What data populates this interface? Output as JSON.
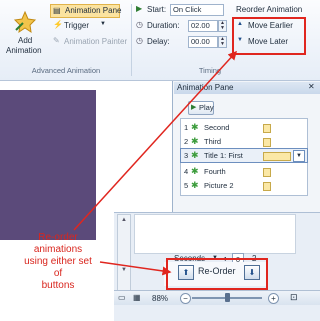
{
  "ribbon": {
    "add_animation_label_1": "Add",
    "add_animation_label_2": "Animation",
    "animation_pane_label": "Animation Pane",
    "trigger_label": "Trigger",
    "animation_painter_label": "Animation Painter",
    "group_advanced_animation": "Advanced Animation",
    "start_label": "Start:",
    "start_value": "On Click",
    "duration_label": "Duration:",
    "duration_value": "02.00",
    "delay_label": "Delay:",
    "delay_value": "00.00",
    "group_timing": "Timing",
    "reorder_title": "Reorder Animation",
    "move_earlier": "Move Earlier",
    "move_later": "Move Later"
  },
  "pane": {
    "title": "Animation Pane",
    "play_label": "Play",
    "items": [
      {
        "num": "1",
        "name": "Second"
      },
      {
        "num": "2",
        "name": "Third"
      },
      {
        "num": "3",
        "name": "Title 1: First"
      },
      {
        "num": "4",
        "name": "Fourth"
      },
      {
        "num": "5",
        "name": "Picture 2"
      }
    ]
  },
  "bottom": {
    "seconds_label": "Seconds",
    "seconds_value": "0",
    "seconds_next": "2",
    "reorder_label": "Re-Order",
    "zoom": "88%"
  },
  "annotation": {
    "line1": "Re-order",
    "line2": "animations",
    "line3": "using either set",
    "line4": "of",
    "line5": "buttons"
  },
  "colors": {
    "highlight": "#e0261f",
    "slide": "#5b4a7a"
  }
}
